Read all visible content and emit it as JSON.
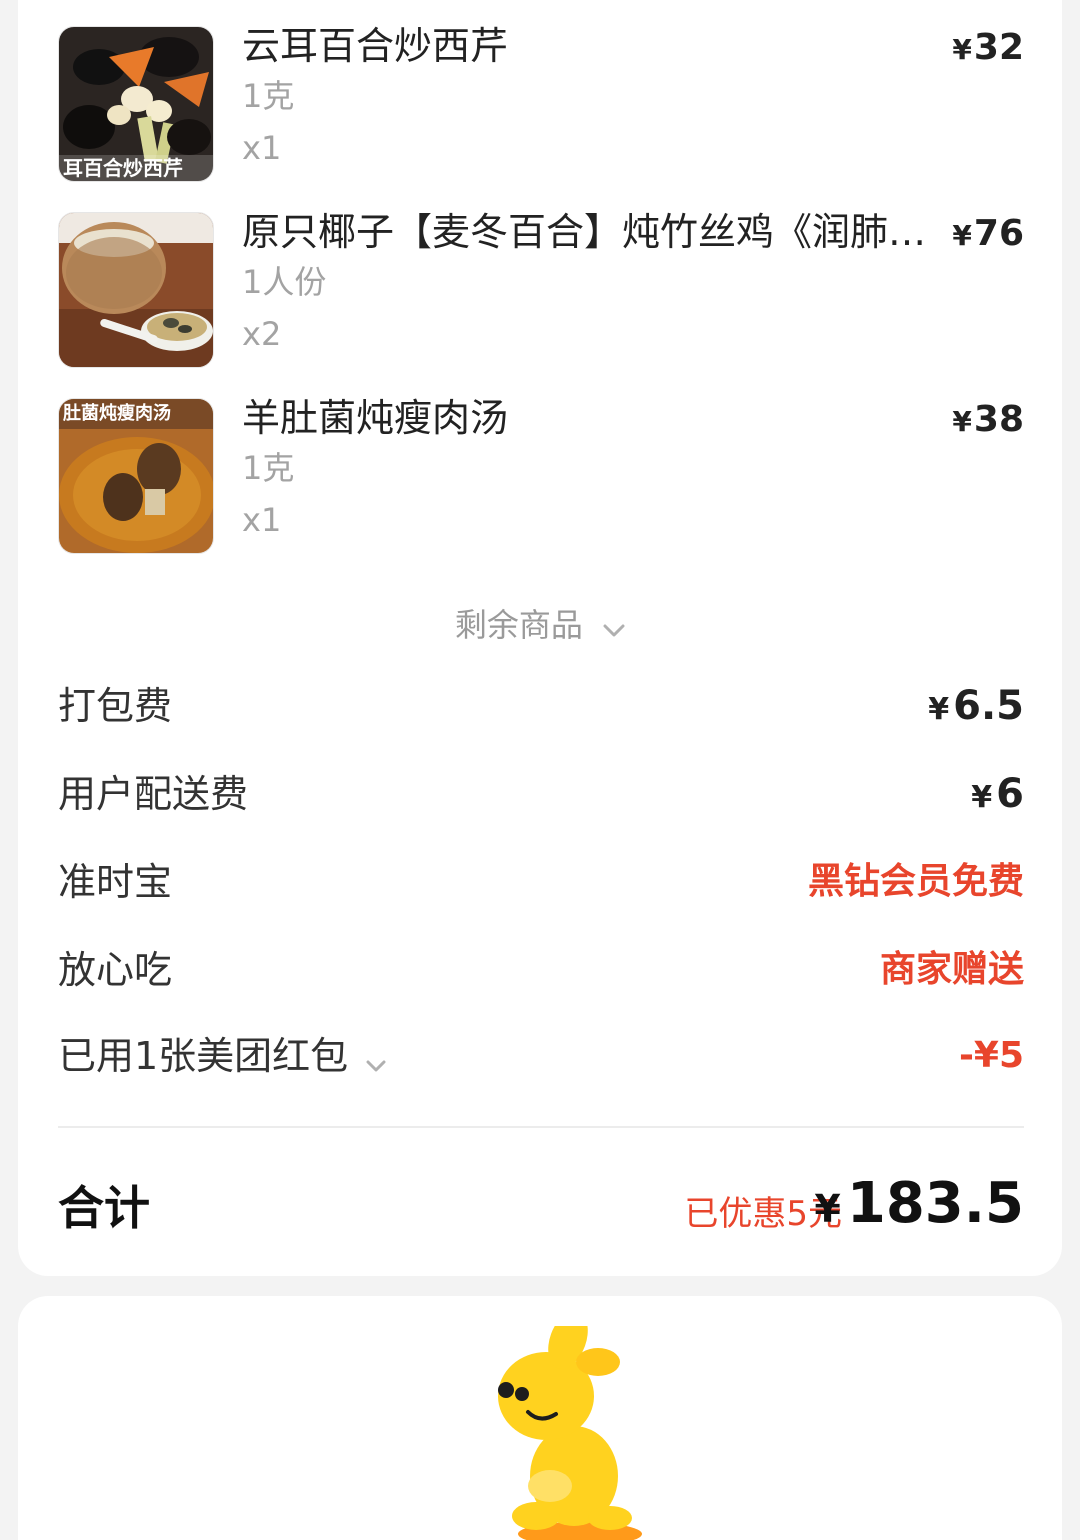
{
  "items": [
    {
      "name": "云耳百合炒西芹",
      "spec": "1克",
      "qty": "x1",
      "price": "32",
      "image": "stir-fried-celery-photo",
      "image_caption": "耳百合炒西芹"
    },
    {
      "name": "原只椰子【麦冬百合】炖竹丝鸡《润肺…",
      "spec": "1人份",
      "qty": "x2",
      "price": "76",
      "image": "coconut-chicken-soup-photo"
    },
    {
      "name": "羊肚菌炖瘦肉汤",
      "spec": "1克",
      "qty": "x1",
      "price": "38",
      "image": "morel-pork-soup-photo",
      "image_caption": "肚菌炖瘦肉汤"
    }
  ],
  "currency": "¥",
  "more_items_label": "剩余商品",
  "fees": {
    "packing_label": "打包费",
    "packing_value": "6.5",
    "delivery_label": "用户配送费",
    "delivery_value": "6",
    "ontime_label": "准时宝",
    "ontime_value": "黑钻会员免费",
    "safe_label": "放心吃",
    "safe_value": "商家赠送",
    "coupon_label": "已用1张美团红包",
    "coupon_value": "-¥5"
  },
  "total": {
    "label": "合计",
    "saved": "已优惠5元",
    "amount": "183.5"
  },
  "colors": {
    "accent_red": "#e8452c",
    "mascot_yellow": "#ffd21f"
  },
  "mascot": "kangaroo-mascot"
}
